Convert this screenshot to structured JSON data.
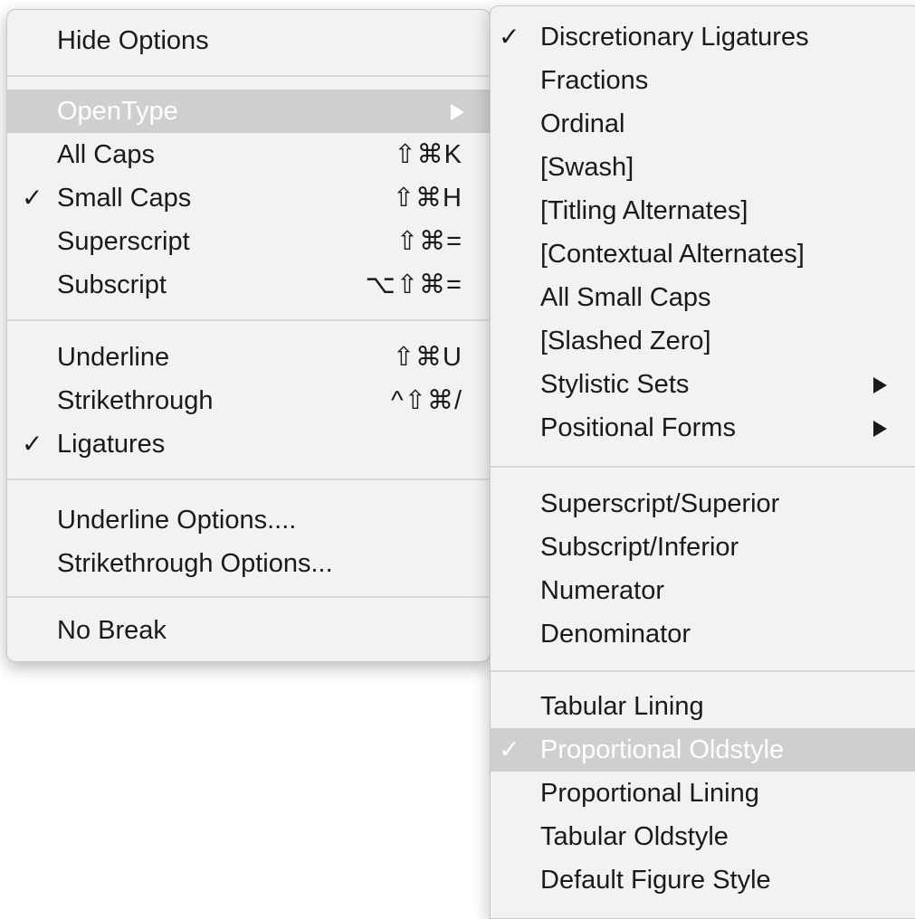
{
  "main_menu": {
    "hide_options": "Hide Options",
    "opentype": "OpenType",
    "all_caps": {
      "label": "All Caps",
      "shortcut": "⇧⌘K"
    },
    "small_caps": {
      "label": "Small Caps",
      "shortcut": "⇧⌘H",
      "check": "✓"
    },
    "superscript": {
      "label": "Superscript",
      "shortcut": "⇧⌘="
    },
    "subscript": {
      "label": "Subscript",
      "shortcut": "⌥⇧⌘="
    },
    "underline": {
      "label": "Underline",
      "shortcut": "⇧⌘U"
    },
    "strikethrough": {
      "label": "Strikethrough",
      "shortcut": "^⇧⌘/"
    },
    "ligatures": {
      "label": "Ligatures",
      "check": "✓"
    },
    "underline_options": "Underline Options....",
    "strikethrough_options": "Strikethrough Options...",
    "no_break": "No Break"
  },
  "submenu": {
    "discretionary_ligatures": {
      "label": "Discretionary Ligatures",
      "check": "✓"
    },
    "fractions": "Fractions",
    "ordinal": "Ordinal",
    "swash": "[Swash]",
    "titling_alternates": "[Titling Alternates]",
    "contextual_alternates": "[Contextual Alternates]",
    "all_small_caps": "All Small Caps",
    "slashed_zero": "[Slashed Zero]",
    "stylistic_sets": "Stylistic Sets",
    "positional_forms": "Positional Forms",
    "superscript_superior": "Superscript/Superior",
    "subscript_inferior": "Subscript/Inferior",
    "numerator": "Numerator",
    "denominator": "Denominator",
    "tabular_lining": "Tabular Lining",
    "proportional_oldstyle": {
      "label": "Proportional Oldstyle",
      "check": "✓"
    },
    "proportional_lining": "Proportional Lining",
    "tabular_oldstyle": "Tabular Oldstyle",
    "default_figure_style": "Default Figure Style"
  },
  "colors": {
    "menu_bg": "#f2f2f2",
    "highlight": "#cfcfcf",
    "text": "#1a1a1a",
    "separator": "#d9d9d9"
  }
}
